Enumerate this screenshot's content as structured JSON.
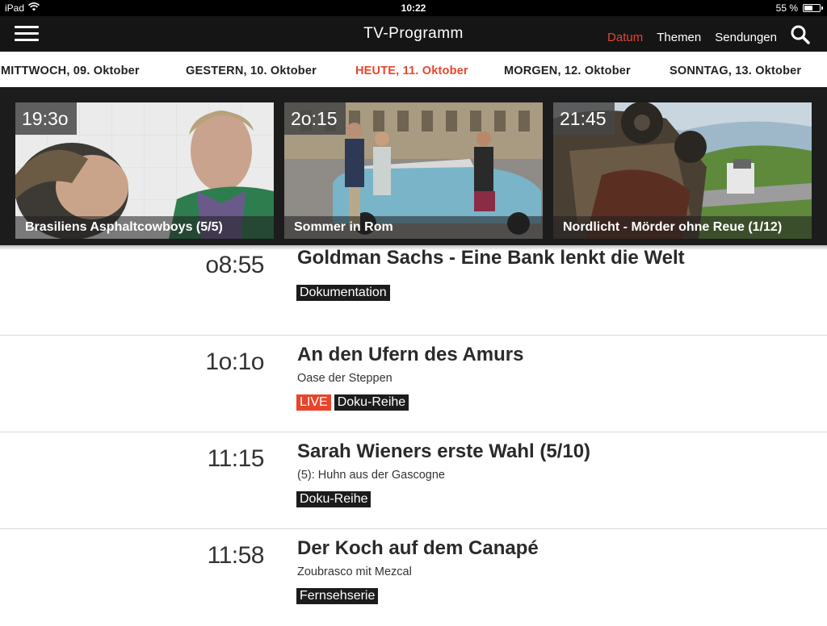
{
  "status_bar": {
    "device": "iPad",
    "time": "10:22",
    "battery": "55 %",
    "battery_level": 0.55
  },
  "nav": {
    "title": "TV-Programm",
    "links": [
      "Datum",
      "Themen",
      "Sendungen"
    ],
    "active_link": "Datum"
  },
  "days": [
    {
      "label": "MITTWOCH, 09. Oktober",
      "active": false
    },
    {
      "label": "GESTERN, 10. Oktober",
      "active": false
    },
    {
      "label": "HEUTE, 11. Oktober",
      "active": true
    },
    {
      "label": "MORGEN, 12. Oktober",
      "active": false
    },
    {
      "label": "SONNTAG, 13. Oktober",
      "active": false
    }
  ],
  "teasers": [
    {
      "time": "19:3o",
      "title": "Brasiliens Asphaltcowboys (5/5)"
    },
    {
      "time": "2o:15",
      "title": "Sommer in Rom"
    },
    {
      "time": "21:45",
      "title": "Nordlicht - Mörder ohne Reue (1/12)"
    }
  ],
  "programs": [
    {
      "time": "o8:55",
      "title": "Goldman Sachs - Eine Bank lenkt die Welt",
      "subtitle": "",
      "live": false,
      "tag": "Dokumentation"
    },
    {
      "time": "1o:1o",
      "title": "An den Ufern des Amurs",
      "subtitle": "Oase der Steppen",
      "live": true,
      "live_label": "LIVE",
      "tag": "Doku-Reihe"
    },
    {
      "time": "11:15",
      "title": "Sarah Wieners erste Wahl (5/10)",
      "subtitle": "(5): Huhn aus der Gascogne",
      "live": false,
      "tag": "Doku-Reihe"
    },
    {
      "time": "11:58",
      "title": "Der Koch auf dem Canapé",
      "subtitle": "Zoubrasco mit Mezcal",
      "live": false,
      "tag": "Fernsehserie"
    }
  ],
  "colors": {
    "accent": "#e8452c",
    "nav_bg": "#151515",
    "tag_bg": "#1c1c1c"
  },
  "icons": {
    "menu": "hamburger-icon",
    "search": "search-icon",
    "wifi": "wifi-icon",
    "battery": "battery-icon"
  }
}
